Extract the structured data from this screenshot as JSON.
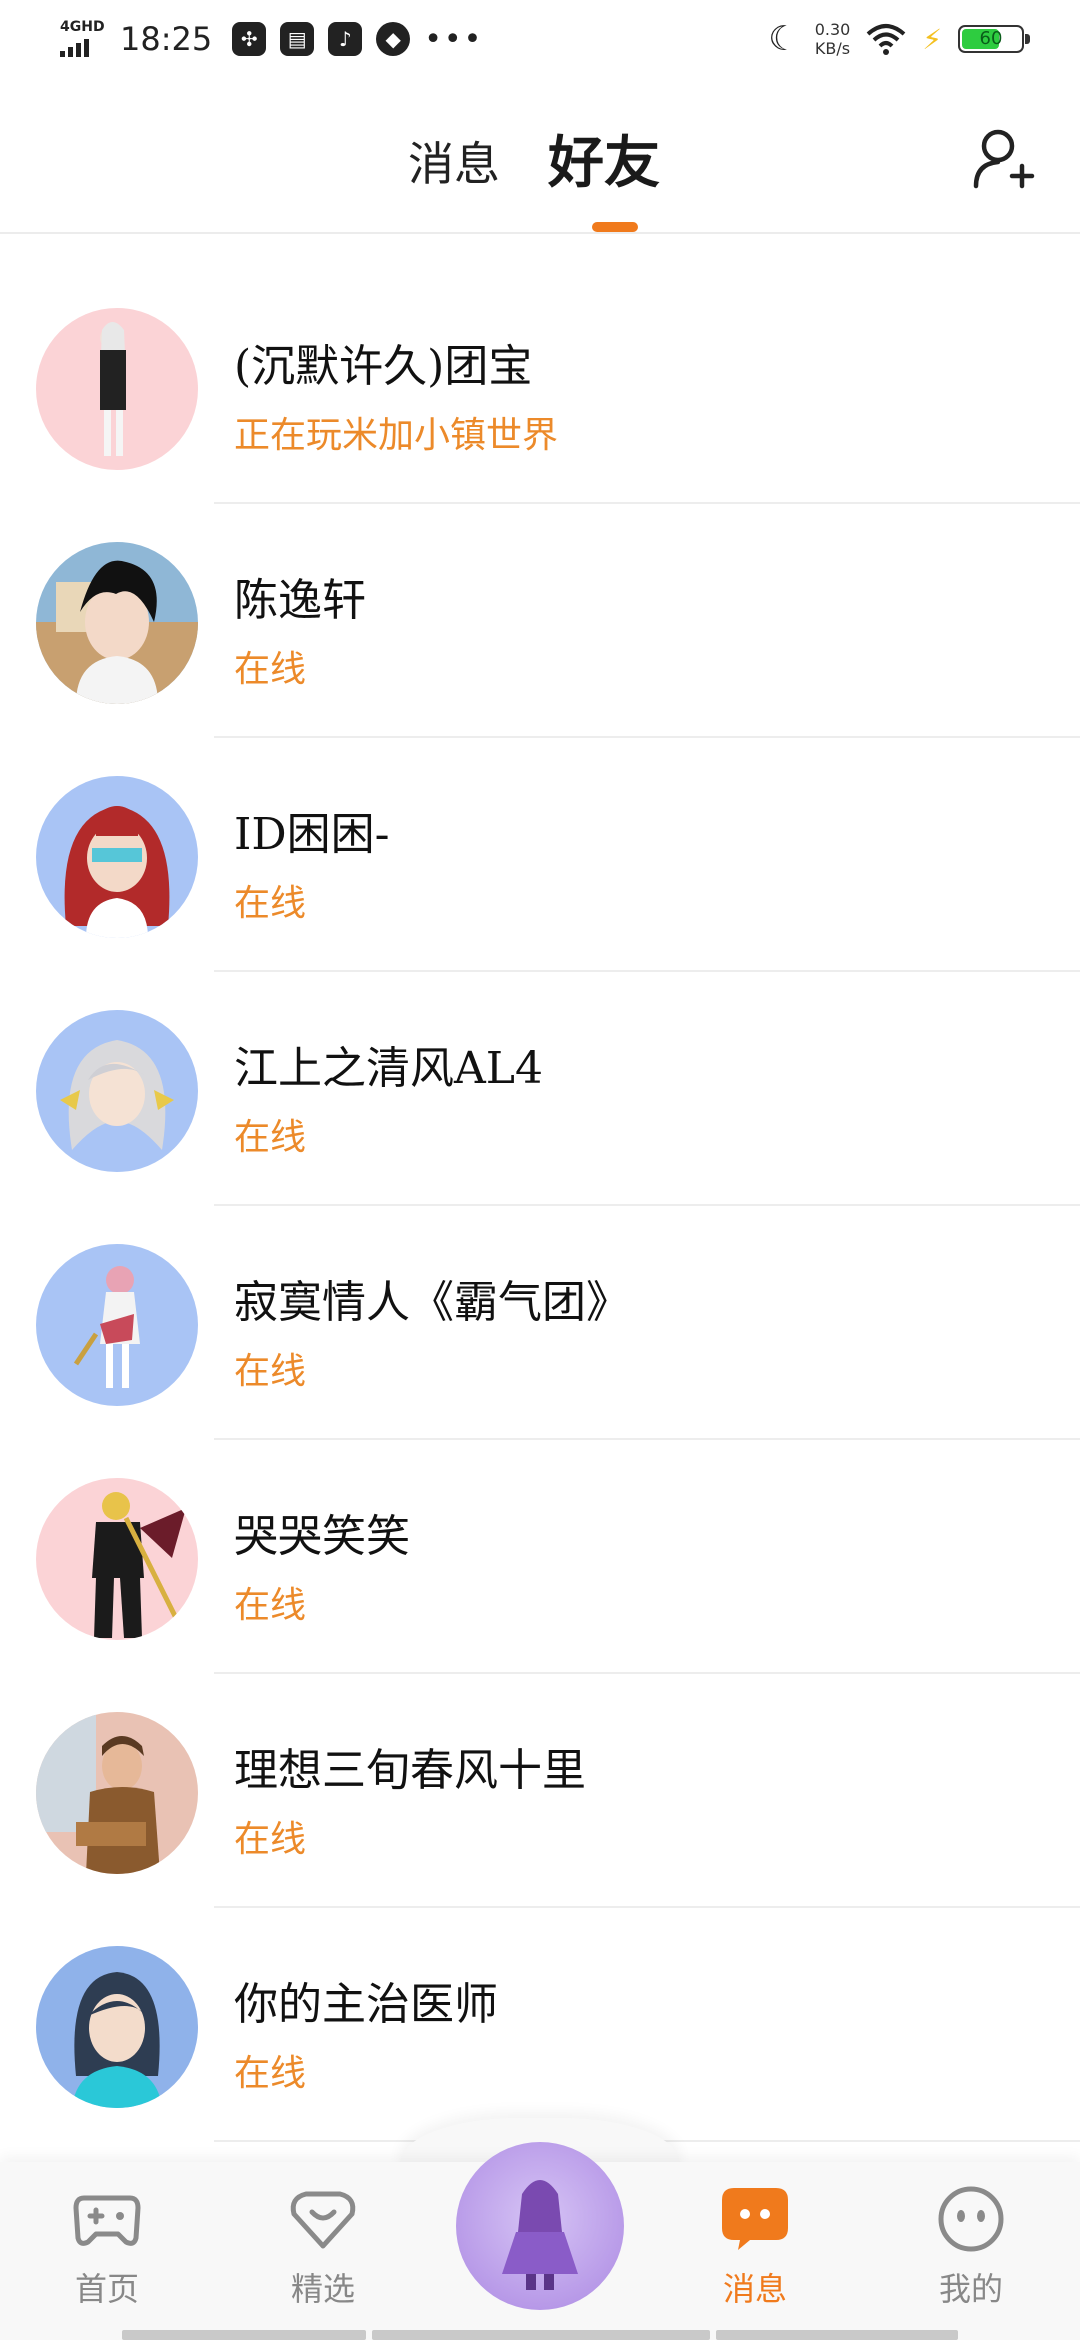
{
  "status_bar": {
    "network": "4GHD",
    "time": "18:25",
    "speed_value": "0.30",
    "speed_unit": "KB/s",
    "battery": "60"
  },
  "header": {
    "tab_messages": "消息",
    "tab_friends": "好友",
    "active_tab": "好友"
  },
  "friends": [
    {
      "name": "(沉默许久)团宝",
      "status": "正在玩米加小镇世界",
      "avatar_bg": "#fbd3d6"
    },
    {
      "name": "陈逸轩",
      "status": "在线",
      "avatar_bg": "#8fb7d6"
    },
    {
      "name": "ID困困-",
      "status": "在线",
      "avatar_bg": "#a9c4f5"
    },
    {
      "name": "江上之清风AL4",
      "status": "在线",
      "avatar_bg": "#a9c4f5"
    },
    {
      "name": "寂寞情人《霸气团》",
      "status": "在线",
      "avatar_bg": "#a9c4f5"
    },
    {
      "name": "哭哭笑笑",
      "status": "在线",
      "avatar_bg": "#fbd3d6"
    },
    {
      "name": "理想三旬春风十里",
      "status": "在线",
      "avatar_bg": "#e9c2b4"
    },
    {
      "name": "你的主治医师",
      "status": "在线",
      "avatar_bg": "#8fb2ea"
    }
  ],
  "bottom_nav": {
    "home": "首页",
    "featured": "精选",
    "messages": "消息",
    "mine": "我的"
  },
  "colors": {
    "accent": "#f07a1c",
    "status_text": "#ec8a2a"
  }
}
